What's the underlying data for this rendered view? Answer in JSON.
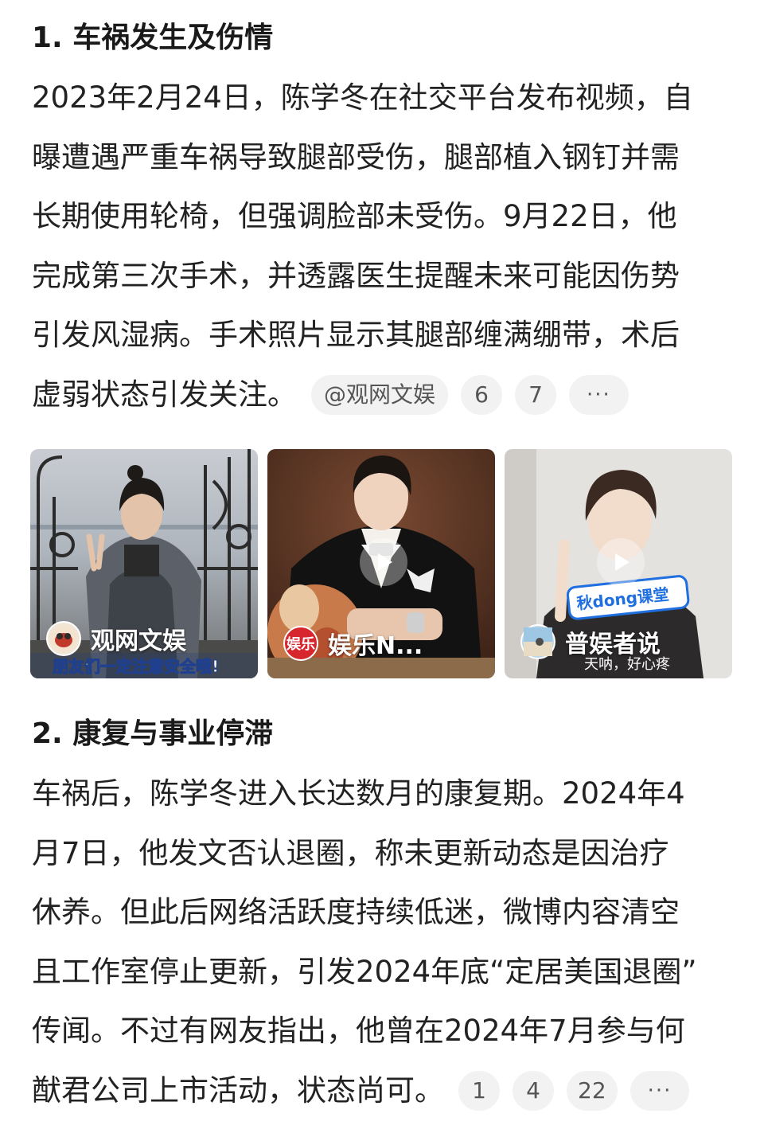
{
  "section1": {
    "heading": "1. 车祸发生及伤情",
    "lines": [
      "2023年2月24日，陈学冬在社交平台发布视频，自",
      "曝遭遇严重车祸导致腿部受伤，腿部植入钢钉并需",
      "长期使用轮椅，但强调脸部未受伤。9月22日，他",
      "完成第三次手术，并透露医生提醒未来可能因伤势",
      "引发风湿病。手术照片显示其腿部缠满绷带，术后",
      "虚弱状态引发关注。"
    ],
    "source_chip": "@观网文娱",
    "ref_chips": [
      "6",
      "7"
    ],
    "more_chip": "···"
  },
  "media": [
    {
      "source_name": "观网文娱",
      "caption": "朋友们一定注意安全哦!",
      "icon": "avatar-icon",
      "is_video": false
    },
    {
      "source_name": "娱乐N...",
      "caption": "",
      "icon": "yule-logo-icon",
      "avatar_text": "娱乐",
      "is_video": true
    },
    {
      "source_name": "普娱者说",
      "caption": "天呐，好心疼",
      "overlay_text": "秋dong课堂",
      "icon": "avatar-icon",
      "is_video": true
    }
  ],
  "section2": {
    "heading": "2. 康复与事业停滞",
    "lines": [
      "车祸后，陈学冬进入长达数月的康复期。2024年4",
      "月7日，他发文否认退圈，称未更新动态是因治疗",
      "休养。但此后网络活跃度持续低迷，微博内容清空",
      "且工作室停止更新，引发2024年底“定居美国退圈”",
      "传闻。不过有网友指出，他曾在2024年7月参与何",
      "猷君公司上市活动，状态尚可。"
    ],
    "ref_chips": [
      "1",
      "4",
      "22"
    ],
    "more_chip": "···"
  },
  "colors": {
    "chip_bg": "#f2f2f2",
    "text": "#222222",
    "chip_text": "#555555"
  }
}
